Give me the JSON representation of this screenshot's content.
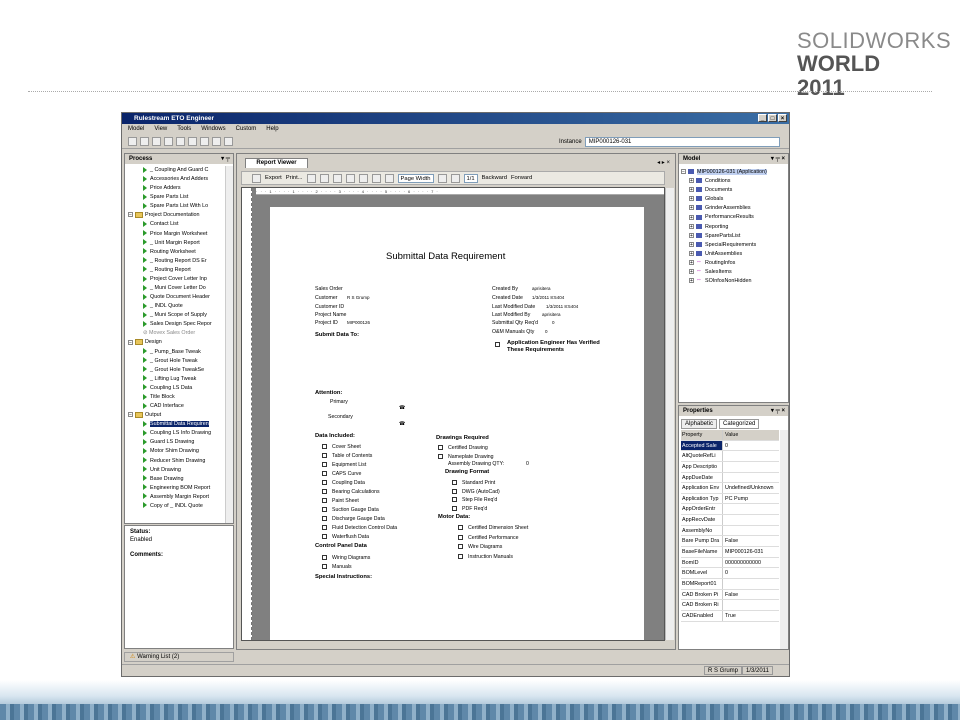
{
  "brand": {
    "line1": "SOLIDWORKS",
    "line2": "WORLD 2011"
  },
  "window": {
    "title": "Rulestream ETO Engineer",
    "controls": [
      "_",
      "□",
      "×"
    ]
  },
  "menu": [
    "Model",
    "View",
    "Tools",
    "Windows",
    "Custom",
    "Help"
  ],
  "instance": {
    "label": "Instance",
    "value": "MIP000126-031"
  },
  "process": {
    "title": "Process",
    "tree": [
      {
        "label": "_ Coupling And Guard C",
        "kind": "leaf",
        "indent": 2
      },
      {
        "label": "Accessories And Adders",
        "kind": "leaf",
        "indent": 2
      },
      {
        "label": "Price Adders",
        "kind": "leaf",
        "indent": 2
      },
      {
        "label": "Spare Parts List",
        "kind": "leaf",
        "indent": 2
      },
      {
        "label": "Spare Parts List With Lo",
        "kind": "leaf",
        "indent": 2
      },
      {
        "label": "Project Documentation",
        "kind": "folder",
        "indent": 0
      },
      {
        "label": "Contact List",
        "kind": "leaf",
        "indent": 2
      },
      {
        "label": "Price Margin Worksheet",
        "kind": "leaf",
        "indent": 2
      },
      {
        "label": "_ Unit Margin Report",
        "kind": "leaf",
        "indent": 2
      },
      {
        "label": "Routing Worksheet",
        "kind": "leaf",
        "indent": 2
      },
      {
        "label": "_ Routing Report DS Er",
        "kind": "leaf",
        "indent": 2
      },
      {
        "label": "_ Routing Report",
        "kind": "leaf",
        "indent": 2
      },
      {
        "label": "Project Cover Letter Inp",
        "kind": "leaf",
        "indent": 2
      },
      {
        "label": "_ Muni Cover Letter Do",
        "kind": "leaf",
        "indent": 2
      },
      {
        "label": "Quote Document Header",
        "kind": "leaf",
        "indent": 2
      },
      {
        "label": "_ INDL Quote",
        "kind": "leaf",
        "indent": 2
      },
      {
        "label": "_ Muni Scope of Supply",
        "kind": "leaf",
        "indent": 2
      },
      {
        "label": "Sales Design Spec Repor",
        "kind": "leaf",
        "indent": 2
      },
      {
        "label": "Movex Sales Order",
        "kind": "disabled",
        "indent": 2
      },
      {
        "label": "Design",
        "kind": "folder",
        "indent": 0
      },
      {
        "label": "_ Pump_Base Tweak",
        "kind": "leaf",
        "indent": 2
      },
      {
        "label": "_ Grout Hole Tweak",
        "kind": "leaf",
        "indent": 2
      },
      {
        "label": "_ Grout Hole TweakSe",
        "kind": "leaf",
        "indent": 2
      },
      {
        "label": "_ Lifting Lug Tweak",
        "kind": "leaf",
        "indent": 2
      },
      {
        "label": "Coupling LS Data",
        "kind": "leaf",
        "indent": 2
      },
      {
        "label": "Title Block",
        "kind": "leaf",
        "indent": 2
      },
      {
        "label": "CAD Interface",
        "kind": "leaf",
        "indent": 2
      },
      {
        "label": "Output",
        "kind": "folder",
        "indent": 0
      },
      {
        "label": "Submittal Data Requiren",
        "kind": "selected",
        "indent": 2
      },
      {
        "label": "Coupling LS Info Drawing",
        "kind": "leaf",
        "indent": 2
      },
      {
        "label": "Guard LS Drawing",
        "kind": "leaf",
        "indent": 2
      },
      {
        "label": "Motor Shim Drawing",
        "kind": "leaf",
        "indent": 2
      },
      {
        "label": "Reducer Shim Drawing",
        "kind": "leaf",
        "indent": 2
      },
      {
        "label": "Unit Drawing",
        "kind": "leaf",
        "indent": 2
      },
      {
        "label": "Base Drawing",
        "kind": "leaf",
        "indent": 2
      },
      {
        "label": "Engineering BOM Report",
        "kind": "leaf",
        "indent": 2
      },
      {
        "label": "Assembly Margin Report",
        "kind": "leaf",
        "indent": 2
      },
      {
        "label": "Copy of _ INDL Quote",
        "kind": "leaf",
        "indent": 2
      }
    ]
  },
  "status": {
    "status_label": "Status:",
    "status_value": "Enabled",
    "comments_label": "Comments:"
  },
  "warning": {
    "label": "Warning List",
    "count": "(2)"
  },
  "reportviewer": {
    "tab": "Report Viewer",
    "export": "Export",
    "print": "Print...",
    "zoom": "Page Width",
    "page": "1/1",
    "backward": "Backward",
    "forward": "Forward",
    "ruler": "· · · 1 · · · · 1 · · · · 2 · · · · 3 · · · · 4 · · · · 5 · · · · 6 · · · · 7 ·"
  },
  "report": {
    "title": "Submittal Data Requirement",
    "sales_order": "Sales Order",
    "customer_label": "Customer",
    "customer_value": "R S Grump",
    "customer_id": "Customer ID",
    "project_name": "Project Name",
    "project_id_label": "Project ID",
    "project_id_value": "MIP000126",
    "created_by_label": "Created By",
    "created_by_value": "aprisitera",
    "created_date_label": "Created Date",
    "created_date_value": "1/3/2011 8:5404",
    "last_mod_date_label": "Last Modified Date",
    "last_mod_date_value": "1/3/2011 8:5404",
    "last_mod_by_label": "Last Modified By",
    "last_mod_by_value": "aprisitera",
    "submittal_qty_label": "Submittal Qty Req'd",
    "submittal_qty_value": "0",
    "om_qty_label": "O&M Manuals Qty",
    "om_qty_value": "0",
    "submit_to": "Submit Data To:",
    "app_eng": "Application Engineer Has Verified These Requirements",
    "attention": "Attention:",
    "primary": "Primary",
    "secondary": "Secondary",
    "data_included": "Data Included:",
    "data_items": [
      "Cover Sheet",
      "Table of Contents",
      "Equipment List",
      "CAPS Curve",
      "Coupling Data",
      "Bearing Calculations",
      "Paint Sheet",
      "Suction Gauge Data",
      "Discharge Gauge Data",
      "Fluid Detection Control Data",
      "Waterflush Data"
    ],
    "control_panel": "Control Panel Data",
    "control_items": [
      "Wiring Diagrams",
      "Manuals"
    ],
    "special": "Special Instructions:",
    "drawings_required": "Drawings Required",
    "drawings_items": [
      "Certified Drawing",
      "Nameplate Drawing"
    ],
    "assembly_qty": "Assembly Drawing QTY:",
    "assembly_qty_value": "0",
    "drawing_format": "Drawing Format",
    "format_items": [
      "Standard Print",
      "DWG (AutoCad)",
      "Step File Req'd",
      "PDF Req'd"
    ],
    "motor_data": "Motor Data:",
    "motor_items": [
      "Certified Dimension Sheet",
      "Certified Performance",
      "Wire Diagrams",
      "Instruction Manuals"
    ]
  },
  "model": {
    "title": "Model",
    "root": "MIP000126-031 (Application)",
    "items": [
      {
        "label": "Conditions",
        "icon": "book-icon"
      },
      {
        "label": "Documents",
        "icon": "book-icon"
      },
      {
        "label": "Globals",
        "icon": "book-icon"
      },
      {
        "label": "GrinderAssemblies",
        "icon": "book-icon"
      },
      {
        "label": "PerformanceResults",
        "icon": "book-icon"
      },
      {
        "label": "Reporting",
        "icon": "book-icon"
      },
      {
        "label": "SparePartsList",
        "icon": "book-icon"
      },
      {
        "label": "SpecialRequirements",
        "icon": "book-icon"
      },
      {
        "label": "UnitAssemblies",
        "icon": "book-icon"
      },
      {
        "label": "RoutingInfos",
        "icon": "link-icon"
      },
      {
        "label": "SalesItems",
        "icon": "link-icon"
      },
      {
        "label": "SOInfosNonHidden",
        "icon": "link-icon"
      }
    ]
  },
  "properties": {
    "title": "Properties",
    "tabs": [
      "Alphabetic",
      "Categorized"
    ],
    "col_property": "Property",
    "col_value": "Value",
    "rows": [
      [
        "Accepted Sale",
        "0"
      ],
      [
        "AltQuoteRefLi",
        ""
      ],
      [
        "App Descriptio",
        ""
      ],
      [
        "AppDueDate",
        ""
      ],
      [
        "Application Env",
        "Undefined/Unknown"
      ],
      [
        "Application Typ",
        "PC Pump"
      ],
      [
        "AppOrderEntr",
        ""
      ],
      [
        "AppRecvDate",
        ""
      ],
      [
        "AssemblyNo",
        ""
      ],
      [
        "Bare Pump Dra",
        "False"
      ],
      [
        "BaseFileName",
        "MIP000126-031"
      ],
      [
        "BomID",
        "000000000000"
      ],
      [
        "BOMLevel",
        "0"
      ],
      [
        "BOMReport01",
        ""
      ],
      [
        "CAD Broken Pi",
        "False"
      ],
      [
        "CAD Broken Ri",
        ""
      ],
      [
        "CADEnabled",
        "True"
      ]
    ]
  },
  "statusbar": {
    "user": "R S Grump",
    "date": "1/3/2011"
  },
  "colors": {
    "title_bar": "#0a246a",
    "selection": "#0a246a",
    "tree_arrow": "#2a9a2a"
  }
}
